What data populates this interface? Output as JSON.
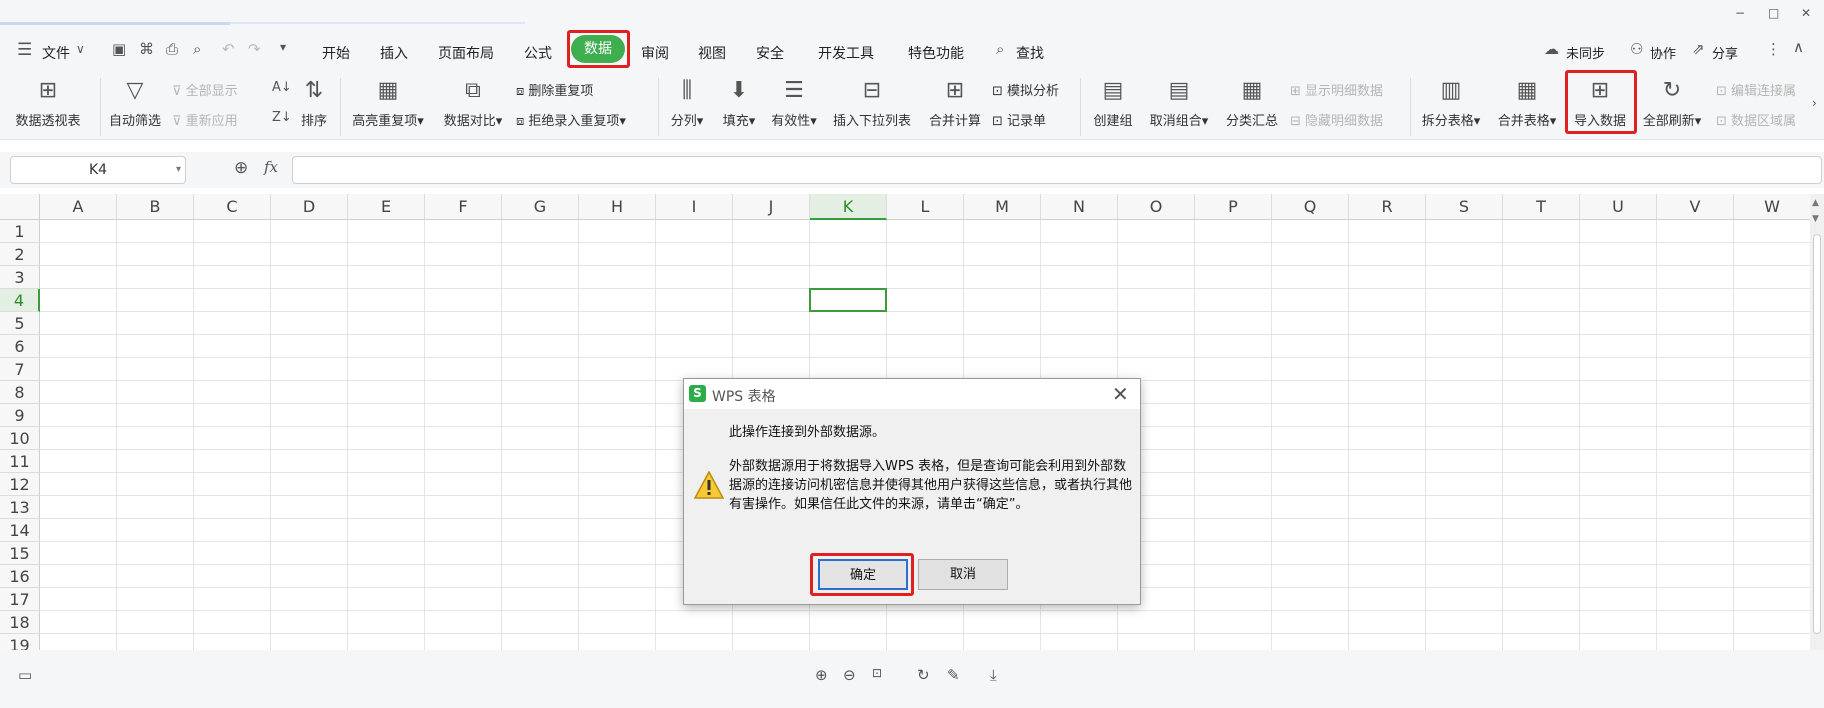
{
  "window": {
    "minimize": "−",
    "maximize": "□",
    "close": "✕"
  },
  "menu": {
    "file_label": "文件",
    "tabs": [
      "开始",
      "插入",
      "页面布局",
      "公式",
      "数据",
      "审阅",
      "视图",
      "安全",
      "开发工具",
      "特色功能"
    ],
    "active_tab": "数据",
    "search_label": "查找",
    "right": {
      "sync": "未同步",
      "collab": "协作",
      "share": "分享"
    }
  },
  "ribbon": {
    "pivot": "数据透视表",
    "autofilter": "自动筛选",
    "show_all": "全部显示",
    "reapply": "重新应用",
    "sort": "排序",
    "highlight_dup": "高亮重复项",
    "compare": "数据对比",
    "remove_dup": "删除重复项",
    "reject_dup": "拒绝录入重复项",
    "split_col": "分列",
    "fill": "填充",
    "validity": "有效性",
    "insert_dropdown": "插入下拉列表",
    "consolidate": "合并计算",
    "what_if": "模拟分析",
    "record_form": "记录单",
    "create_group": "创建组",
    "ungroup": "取消组合",
    "subtotal": "分类汇总",
    "show_detail": "显示明细数据",
    "hide_detail": "隐藏明细数据",
    "split_table": "拆分表格",
    "merge_table": "合并表格",
    "import_data": "导入数据",
    "refresh_all": "全部刷新",
    "edit_connection": "编辑连接属",
    "data_range": "数据区域属"
  },
  "formula_bar": {
    "name_box": "K4",
    "fx_label": "fx",
    "value": ""
  },
  "grid": {
    "columns": [
      "A",
      "B",
      "C",
      "D",
      "E",
      "F",
      "G",
      "H",
      "I",
      "J",
      "K",
      "L",
      "M",
      "N",
      "O",
      "P",
      "Q",
      "R",
      "S",
      "T",
      "U",
      "V",
      "W"
    ],
    "rows": [
      "1",
      "2",
      "3",
      "4",
      "5",
      "6",
      "7",
      "8",
      "9",
      "10",
      "11",
      "12",
      "13",
      "14",
      "15",
      "16",
      "17",
      "18",
      "19"
    ],
    "selected_cell": "K4"
  },
  "dialog": {
    "title": "WPS 表格",
    "message1": "此操作连接到外部数据源。",
    "message2": "外部数据源用于将数据导入WPS 表格，但是查询可能会利用到外部数据源的连接访问机密信息并使得其他用户获得这些信息，或者执行其他有害操作。如果信任此文件的来源，请单击“确定”。",
    "ok_label": "确定",
    "cancel_label": "取消"
  },
  "colors": {
    "accent": "#3fae4f",
    "highlight": "#e02020",
    "selection": "#3a9c3a"
  }
}
